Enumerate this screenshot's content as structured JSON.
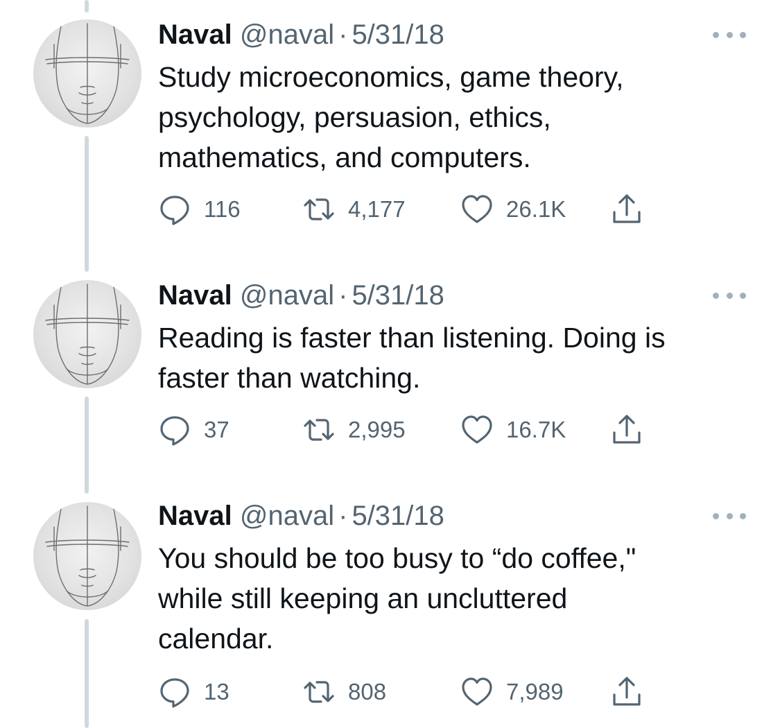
{
  "tweets": [
    {
      "name": "Naval",
      "handle": "@naval",
      "separator": "·",
      "date": "5/31/18",
      "text_lines": [
        "Study microeconomics, game theory,",
        "psychology, persuasion, ethics,",
        "mathematics, and computers."
      ],
      "replies": "116",
      "retweets": "4,177",
      "likes": "26.1K"
    },
    {
      "name": "Naval",
      "handle": "@naval",
      "separator": "·",
      "date": "5/31/18",
      "text_lines": [
        "Reading is faster than listening. Doing is",
        "faster than watching."
      ],
      "replies": "37",
      "retweets": "2,995",
      "likes": "16.7K"
    },
    {
      "name": "Naval",
      "handle": "@naval",
      "separator": "·",
      "date": "5/31/18",
      "text_lines": [
        "You should be too busy to “do coffee,\"",
        "while still keeping an uncluttered",
        "calendar."
      ],
      "replies": "13",
      "retweets": "808",
      "likes": "7,989"
    }
  ],
  "icons": {
    "reply": "reply-icon",
    "retweet": "retweet-icon",
    "like": "heart-icon",
    "share": "share-icon",
    "more": "more-options-icon"
  },
  "colors": {
    "text": "#0f1419",
    "secondary": "#536471",
    "thread_line": "#cfd9de"
  }
}
